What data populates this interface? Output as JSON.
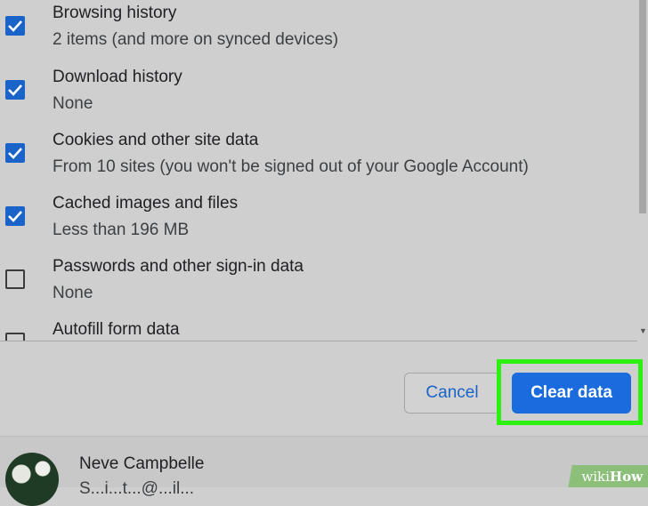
{
  "items": [
    {
      "title": "Browsing history",
      "subtitle": "2 items (and more on synced devices)",
      "checked": true
    },
    {
      "title": "Download history",
      "subtitle": "None",
      "checked": true
    },
    {
      "title": "Cookies and other site data",
      "subtitle": "From 10 sites (you won't be signed out of your Google Account)",
      "checked": true
    },
    {
      "title": "Cached images and files",
      "subtitle": "Less than 196 MB",
      "checked": true
    },
    {
      "title": "Passwords and other sign-in data",
      "subtitle": "None",
      "checked": false
    },
    {
      "title": "Autofill form data",
      "subtitle": "",
      "checked": false
    }
  ],
  "buttons": {
    "cancel_label": "Cancel",
    "clear_label": "Clear data"
  },
  "account": {
    "name": "Neve Campbelle",
    "email": "S...i...t...@...il..."
  },
  "watermark": {
    "prefix": "wiki",
    "suffix": "How"
  },
  "icons": {
    "checkbox_checked": "checkmark-icon",
    "scroll_down": "scroll-down-arrow-icon"
  },
  "colors": {
    "accent": "#1a6cde",
    "highlight": "#2cf00f",
    "background": "#cfcfcf"
  }
}
